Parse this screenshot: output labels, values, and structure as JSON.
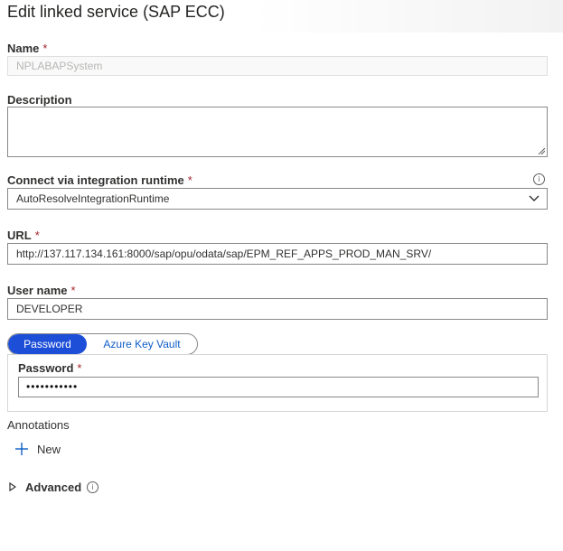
{
  "panel": {
    "title": "Edit linked service (SAP ECC)"
  },
  "form": {
    "name": {
      "label": "Name",
      "required_mark": "*",
      "value": "NPLABAPSystem"
    },
    "description": {
      "label": "Description",
      "value": ""
    },
    "runtime": {
      "label": "Connect via integration runtime",
      "required_mark": "*",
      "value": "AutoResolveIntegrationRuntime",
      "info_icon": "info-icon"
    },
    "url": {
      "label": "URL",
      "required_mark": "*",
      "value": "http://137.117.134.161:8000/sap/opu/odata/sap/EPM_REF_APPS_PROD_MAN_SRV/"
    },
    "username": {
      "label": "User name",
      "required_mark": "*",
      "value": "DEVELOPER"
    },
    "auth_toggle": {
      "options": [
        "Password",
        "Azure Key Vault"
      ],
      "selected": "Password"
    },
    "password": {
      "label": "Password",
      "required_mark": "*",
      "value": "•••••••••••"
    },
    "annotations": {
      "label": "Annotations",
      "new_label": "New"
    },
    "advanced": {
      "label": "Advanced",
      "info_icon": "info-icon"
    }
  },
  "colors": {
    "accent": "#1d4ed8",
    "link": "#0f5dc7",
    "required": "#a4262c",
    "border": "#8a8886"
  }
}
